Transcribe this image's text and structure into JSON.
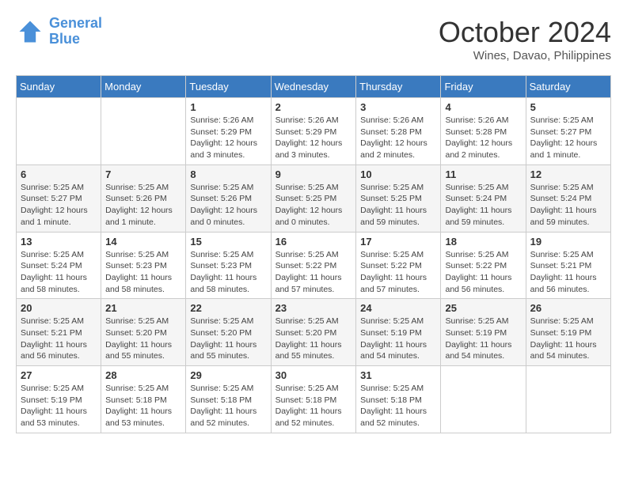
{
  "header": {
    "logo_line1": "General",
    "logo_line2": "Blue",
    "month_year": "October 2024",
    "location": "Wines, Davao, Philippines"
  },
  "weekdays": [
    "Sunday",
    "Monday",
    "Tuesday",
    "Wednesday",
    "Thursday",
    "Friday",
    "Saturday"
  ],
  "weeks": [
    [
      {
        "day": "",
        "sunrise": "",
        "sunset": "",
        "daylight": ""
      },
      {
        "day": "",
        "sunrise": "",
        "sunset": "",
        "daylight": ""
      },
      {
        "day": "1",
        "sunrise": "Sunrise: 5:26 AM",
        "sunset": "Sunset: 5:29 PM",
        "daylight": "Daylight: 12 hours and 3 minutes."
      },
      {
        "day": "2",
        "sunrise": "Sunrise: 5:26 AM",
        "sunset": "Sunset: 5:29 PM",
        "daylight": "Daylight: 12 hours and 3 minutes."
      },
      {
        "day": "3",
        "sunrise": "Sunrise: 5:26 AM",
        "sunset": "Sunset: 5:28 PM",
        "daylight": "Daylight: 12 hours and 2 minutes."
      },
      {
        "day": "4",
        "sunrise": "Sunrise: 5:26 AM",
        "sunset": "Sunset: 5:28 PM",
        "daylight": "Daylight: 12 hours and 2 minutes."
      },
      {
        "day": "5",
        "sunrise": "Sunrise: 5:25 AM",
        "sunset": "Sunset: 5:27 PM",
        "daylight": "Daylight: 12 hours and 1 minute."
      }
    ],
    [
      {
        "day": "6",
        "sunrise": "Sunrise: 5:25 AM",
        "sunset": "Sunset: 5:27 PM",
        "daylight": "Daylight: 12 hours and 1 minute."
      },
      {
        "day": "7",
        "sunrise": "Sunrise: 5:25 AM",
        "sunset": "Sunset: 5:26 PM",
        "daylight": "Daylight: 12 hours and 1 minute."
      },
      {
        "day": "8",
        "sunrise": "Sunrise: 5:25 AM",
        "sunset": "Sunset: 5:26 PM",
        "daylight": "Daylight: 12 hours and 0 minutes."
      },
      {
        "day": "9",
        "sunrise": "Sunrise: 5:25 AM",
        "sunset": "Sunset: 5:25 PM",
        "daylight": "Daylight: 12 hours and 0 minutes."
      },
      {
        "day": "10",
        "sunrise": "Sunrise: 5:25 AM",
        "sunset": "Sunset: 5:25 PM",
        "daylight": "Daylight: 11 hours and 59 minutes."
      },
      {
        "day": "11",
        "sunrise": "Sunrise: 5:25 AM",
        "sunset": "Sunset: 5:24 PM",
        "daylight": "Daylight: 11 hours and 59 minutes."
      },
      {
        "day": "12",
        "sunrise": "Sunrise: 5:25 AM",
        "sunset": "Sunset: 5:24 PM",
        "daylight": "Daylight: 11 hours and 59 minutes."
      }
    ],
    [
      {
        "day": "13",
        "sunrise": "Sunrise: 5:25 AM",
        "sunset": "Sunset: 5:24 PM",
        "daylight": "Daylight: 11 hours and 58 minutes."
      },
      {
        "day": "14",
        "sunrise": "Sunrise: 5:25 AM",
        "sunset": "Sunset: 5:23 PM",
        "daylight": "Daylight: 11 hours and 58 minutes."
      },
      {
        "day": "15",
        "sunrise": "Sunrise: 5:25 AM",
        "sunset": "Sunset: 5:23 PM",
        "daylight": "Daylight: 11 hours and 58 minutes."
      },
      {
        "day": "16",
        "sunrise": "Sunrise: 5:25 AM",
        "sunset": "Sunset: 5:22 PM",
        "daylight": "Daylight: 11 hours and 57 minutes."
      },
      {
        "day": "17",
        "sunrise": "Sunrise: 5:25 AM",
        "sunset": "Sunset: 5:22 PM",
        "daylight": "Daylight: 11 hours and 57 minutes."
      },
      {
        "day": "18",
        "sunrise": "Sunrise: 5:25 AM",
        "sunset": "Sunset: 5:22 PM",
        "daylight": "Daylight: 11 hours and 56 minutes."
      },
      {
        "day": "19",
        "sunrise": "Sunrise: 5:25 AM",
        "sunset": "Sunset: 5:21 PM",
        "daylight": "Daylight: 11 hours and 56 minutes."
      }
    ],
    [
      {
        "day": "20",
        "sunrise": "Sunrise: 5:25 AM",
        "sunset": "Sunset: 5:21 PM",
        "daylight": "Daylight: 11 hours and 56 minutes."
      },
      {
        "day": "21",
        "sunrise": "Sunrise: 5:25 AM",
        "sunset": "Sunset: 5:20 PM",
        "daylight": "Daylight: 11 hours and 55 minutes."
      },
      {
        "day": "22",
        "sunrise": "Sunrise: 5:25 AM",
        "sunset": "Sunset: 5:20 PM",
        "daylight": "Daylight: 11 hours and 55 minutes."
      },
      {
        "day": "23",
        "sunrise": "Sunrise: 5:25 AM",
        "sunset": "Sunset: 5:20 PM",
        "daylight": "Daylight: 11 hours and 55 minutes."
      },
      {
        "day": "24",
        "sunrise": "Sunrise: 5:25 AM",
        "sunset": "Sunset: 5:19 PM",
        "daylight": "Daylight: 11 hours and 54 minutes."
      },
      {
        "day": "25",
        "sunrise": "Sunrise: 5:25 AM",
        "sunset": "Sunset: 5:19 PM",
        "daylight": "Daylight: 11 hours and 54 minutes."
      },
      {
        "day": "26",
        "sunrise": "Sunrise: 5:25 AM",
        "sunset": "Sunset: 5:19 PM",
        "daylight": "Daylight: 11 hours and 54 minutes."
      }
    ],
    [
      {
        "day": "27",
        "sunrise": "Sunrise: 5:25 AM",
        "sunset": "Sunset: 5:19 PM",
        "daylight": "Daylight: 11 hours and 53 minutes."
      },
      {
        "day": "28",
        "sunrise": "Sunrise: 5:25 AM",
        "sunset": "Sunset: 5:18 PM",
        "daylight": "Daylight: 11 hours and 53 minutes."
      },
      {
        "day": "29",
        "sunrise": "Sunrise: 5:25 AM",
        "sunset": "Sunset: 5:18 PM",
        "daylight": "Daylight: 11 hours and 52 minutes."
      },
      {
        "day": "30",
        "sunrise": "Sunrise: 5:25 AM",
        "sunset": "Sunset: 5:18 PM",
        "daylight": "Daylight: 11 hours and 52 minutes."
      },
      {
        "day": "31",
        "sunrise": "Sunrise: 5:25 AM",
        "sunset": "Sunset: 5:18 PM",
        "daylight": "Daylight: 11 hours and 52 minutes."
      },
      {
        "day": "",
        "sunrise": "",
        "sunset": "",
        "daylight": ""
      },
      {
        "day": "",
        "sunrise": "",
        "sunset": "",
        "daylight": ""
      }
    ]
  ]
}
